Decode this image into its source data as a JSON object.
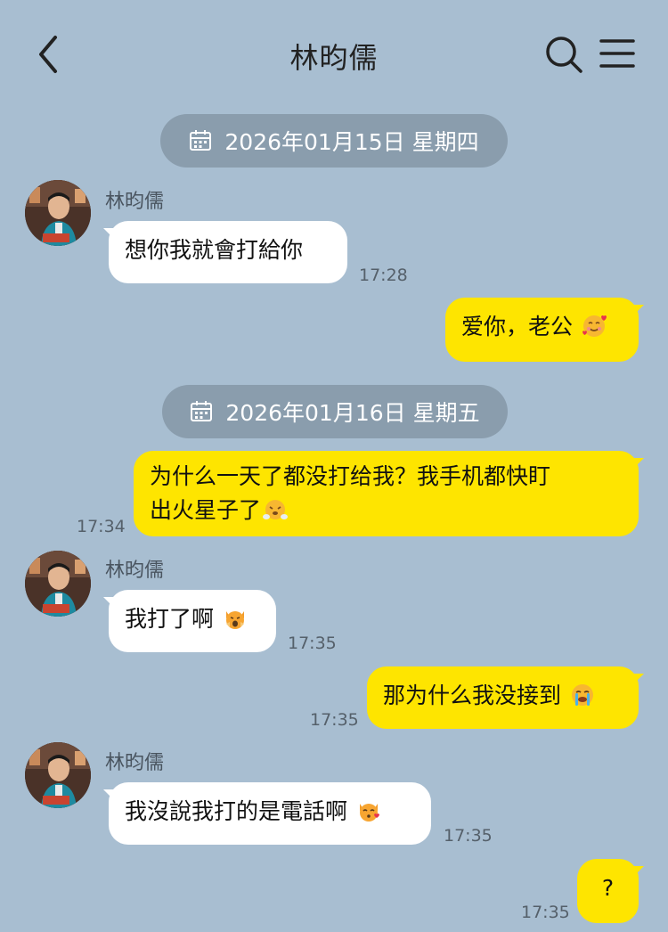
{
  "header": {
    "title": "林昀儒"
  },
  "icons": {
    "back": "chevron-left-icon",
    "search": "search-icon",
    "menu": "hamburger-menu-icon",
    "calendar": "calendar-icon"
  },
  "colors": {
    "background": "#a8bed1",
    "outgoing_bubble": "#fee500",
    "incoming_bubble": "#ffffff",
    "date_pill": "#8a9dad"
  },
  "dates": [
    {
      "label": "2026年01月15日 星期四"
    },
    {
      "label": "2026年01月16日 星期五"
    }
  ],
  "messages": [
    {
      "direction": "in",
      "sender": "林昀儒",
      "text": "想你我就會打給你",
      "time": "17:28"
    },
    {
      "direction": "out",
      "text": "爱你，老公",
      "emoji": "smiling-face-with-hearts",
      "time": ""
    },
    {
      "direction": "out",
      "line1": "为什么一天了都没打给我？我手机都快盯",
      "line2": "出火星子了",
      "emoji": "face-with-steam",
      "time": "17:34"
    },
    {
      "direction": "in",
      "sender": "林昀儒",
      "text": "我打了啊",
      "emoji": "weary-cat-face",
      "time": "17:35"
    },
    {
      "direction": "out",
      "text": "那为什么我没接到",
      "emoji": "loudly-crying-face",
      "time": "17:35"
    },
    {
      "direction": "in",
      "sender": "林昀儒",
      "text": "我沒說我打的是電話啊",
      "emoji": "kissing-cat-face",
      "time": "17:35"
    },
    {
      "direction": "out",
      "text": "?",
      "time": "17:35"
    }
  ]
}
